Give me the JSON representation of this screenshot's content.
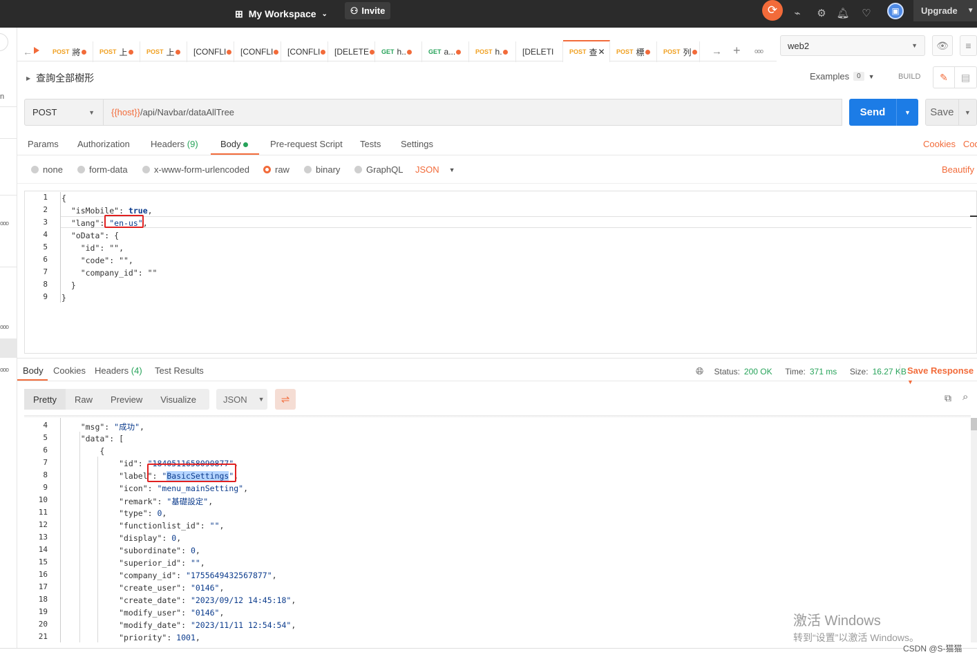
{
  "topbar": {
    "workspace": "My Workspace",
    "invite": "Invite",
    "upgrade": "Upgrade"
  },
  "tabs": [
    {
      "method": "POST",
      "label": "將",
      "color": "#f0a020"
    },
    {
      "method": "POST",
      "label": "上",
      "color": "#f0a020"
    },
    {
      "method": "POST",
      "label": "上",
      "color": "#f0a020"
    },
    {
      "method": "",
      "label": "[CONFLI",
      "color": "#333333"
    },
    {
      "method": "",
      "label": "[CONFLI",
      "color": "#333333"
    },
    {
      "method": "",
      "label": "[CONFLI",
      "color": "#333333"
    },
    {
      "method": "",
      "label": "[DELETE",
      "color": "#333333"
    },
    {
      "method": "GET",
      "label": "h..",
      "color": "#27a35a"
    },
    {
      "method": "GET",
      "label": "a...",
      "color": "#27a35a"
    },
    {
      "method": "POST",
      "label": "h.",
      "color": "#f0a020"
    },
    {
      "method": "",
      "label": "[DELETI",
      "color": "#333333"
    },
    {
      "method": "POST",
      "label": "查",
      "color": "#f0a020"
    },
    {
      "method": "POST",
      "label": "標",
      "color": "#f0a020"
    },
    {
      "method": "POST",
      "label": "列",
      "color": "#f0a020"
    }
  ],
  "environment": "web2",
  "request": {
    "title": "查詢全部樹形",
    "examples_label": "Examples",
    "examples_count": "0",
    "build": "BUILD",
    "method": "POST",
    "url_var": "{{host}}",
    "url_path": "/api/Navbar/dataAllTree",
    "send": "Send",
    "save": "Save"
  },
  "request_tabs": {
    "params": "Params",
    "authorization": "Authorization",
    "headers": "Headers",
    "headers_count": "(9)",
    "body": "Body",
    "prerequest": "Pre-request Script",
    "tests": "Tests",
    "settings": "Settings",
    "cookies": "Cookies",
    "code": "Code"
  },
  "body_types": {
    "none": "none",
    "form_data": "form-data",
    "urlencoded": "x-www-form-urlencoded",
    "raw": "raw",
    "binary": "binary",
    "graphql": "GraphQL",
    "json": "JSON",
    "beautify": "Beautify"
  },
  "request_body": [
    "{",
    "  \"isMobile\": true,",
    "  \"lang\": \"en-us\",",
    "  \"oData\": {",
    "    \"id\": \"\",",
    "    \"code\": \"\",",
    "    \"company_id\": \"\"",
    "  }",
    "}"
  ],
  "response_tabs": {
    "body": "Body",
    "cookies": "Cookies",
    "headers": "Headers",
    "headers_count": "(4)",
    "test_results": "Test Results"
  },
  "response_status": {
    "status_label": "Status:",
    "status": "200 OK",
    "time_label": "Time:",
    "time": "371 ms",
    "size_label": "Size:",
    "size": "16.27 KB",
    "save_response": "Save Response"
  },
  "response_formats": {
    "pretty": "Pretty",
    "raw": "Raw",
    "preview": "Preview",
    "visualize": "Visualize",
    "json": "JSON"
  },
  "response_body": [
    {
      "n": "4",
      "t": "    \"msg\": \"成功\","
    },
    {
      "n": "5",
      "t": "    \"data\": ["
    },
    {
      "n": "6",
      "t": "        {"
    },
    {
      "n": "7",
      "t": "            \"id\": \"1840511658090877\","
    },
    {
      "n": "8",
      "t": "            \"label\": \"BasicSettings\","
    },
    {
      "n": "9",
      "t": "            \"icon\": \"menu_mainSetting\","
    },
    {
      "n": "10",
      "t": "            \"remark\": \"基礎設定\","
    },
    {
      "n": "11",
      "t": "            \"type\": 0,"
    },
    {
      "n": "12",
      "t": "            \"functionlist_id\": \"\","
    },
    {
      "n": "13",
      "t": "            \"display\": 0,"
    },
    {
      "n": "14",
      "t": "            \"subordinate\": 0,"
    },
    {
      "n": "15",
      "t": "            \"superior_id\": \"\","
    },
    {
      "n": "16",
      "t": "            \"company_id\": \"1755649432567877\","
    },
    {
      "n": "17",
      "t": "            \"create_user\": \"0146\","
    },
    {
      "n": "18",
      "t": "            \"create_date\": \"2023/09/12 14:45:18\","
    },
    {
      "n": "19",
      "t": "            \"modify_user\": \"0146\","
    },
    {
      "n": "20",
      "t": "            \"modify_date\": \"2023/11/11 12:54:54\","
    },
    {
      "n": "21",
      "t": "            \"priority\": 1001,"
    }
  ],
  "watermark": {
    "line1": "激活 Windows",
    "line2": "转到“设置”以激活 Windows。"
  },
  "credit": "CSDN @S-猫猫"
}
